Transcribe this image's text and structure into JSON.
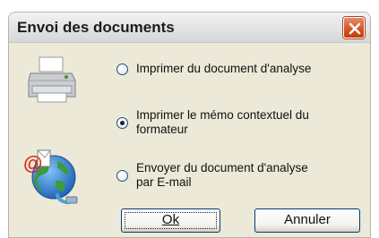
{
  "dialog": {
    "title": "Envoi des documents"
  },
  "options": [
    {
      "label_lines": [
        "Imprimer du document d'analyse"
      ],
      "checked": false
    },
    {
      "label_lines": [
        "Imprimer le mémo contextuel du",
        "formateur"
      ],
      "checked": true
    },
    {
      "label_lines": [
        "Envoyer du document d'analyse",
        "par E-mail"
      ],
      "checked": false
    }
  ],
  "buttons": {
    "ok_label": "Ok",
    "cancel_label": "Annuler"
  },
  "icons": {
    "printer": "printer-icon",
    "globe": "email-globe-icon",
    "close": "close-icon"
  },
  "colors": {
    "dialog_bg": "#ece9d8",
    "close_button": "#d3541e"
  }
}
